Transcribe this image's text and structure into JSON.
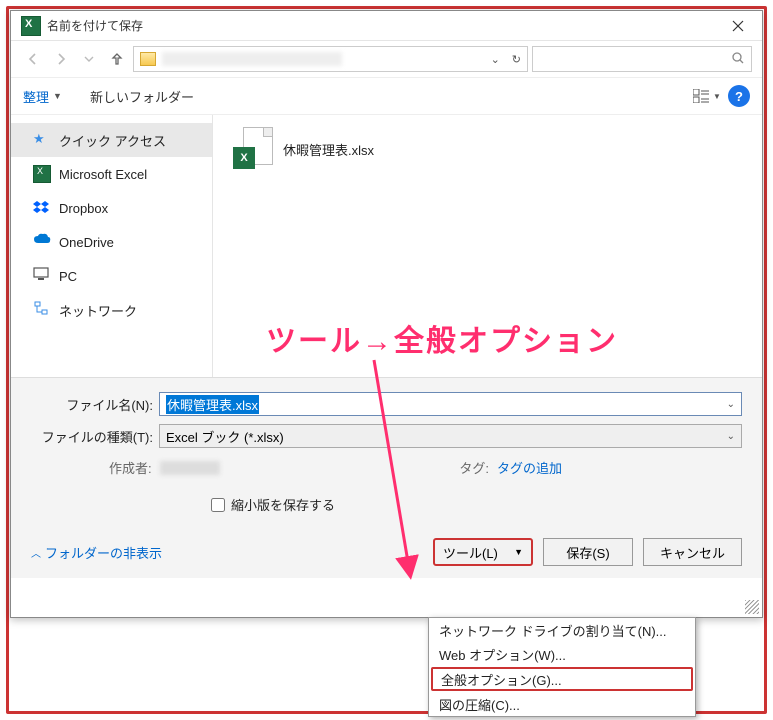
{
  "titlebar": {
    "title": "名前を付けて保存"
  },
  "toolbar": {
    "organize": "整理",
    "newfolder": "新しいフォルダー"
  },
  "sidebar": {
    "items": [
      {
        "label": "クイック アクセス"
      },
      {
        "label": "Microsoft Excel"
      },
      {
        "label": "Dropbox"
      },
      {
        "label": "OneDrive"
      },
      {
        "label": "PC"
      },
      {
        "label": "ネットワーク"
      }
    ]
  },
  "file": {
    "name": "休暇管理表.xlsx"
  },
  "form": {
    "filename_label": "ファイル名(N):",
    "filename_value": "休暇管理表.xlsx",
    "filetype_label": "ファイルの種類(T):",
    "filetype_value": "Excel ブック (*.xlsx)",
    "author_label": "作成者:",
    "tag_label": "タグ:",
    "tag_value": "タグの追加",
    "thumb_label": "縮小版を保存する"
  },
  "buttons": {
    "folder_toggle": "フォルダーの非表示",
    "tools": "ツール(L)",
    "save": "保存(S)",
    "cancel": "キャンセル"
  },
  "menu": {
    "items": [
      "ネットワーク ドライブの割り当て(N)...",
      "Web オプション(W)...",
      "全般オプション(G)...",
      "図の圧縮(C)..."
    ]
  },
  "annotation": {
    "text": "ツール→全般オプション"
  }
}
